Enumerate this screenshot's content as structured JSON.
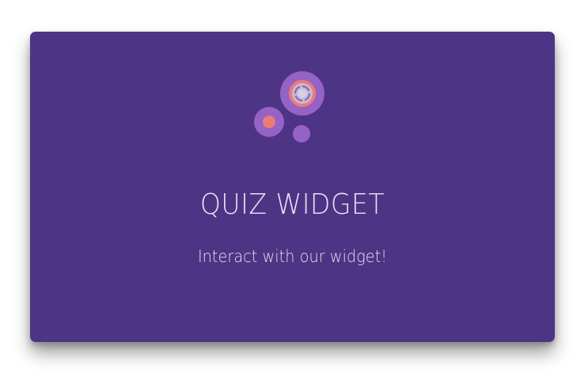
{
  "widget": {
    "title": "QUIZ WIDGET",
    "subtitle": "Interact with our widget!",
    "logo_icon": "bubbles-logo-icon"
  },
  "colors": {
    "card_background": "#4e3484",
    "bubble_purple": "#9562c6",
    "bubble_coral": "#ec7b77",
    "text": "#e9e3f4"
  }
}
